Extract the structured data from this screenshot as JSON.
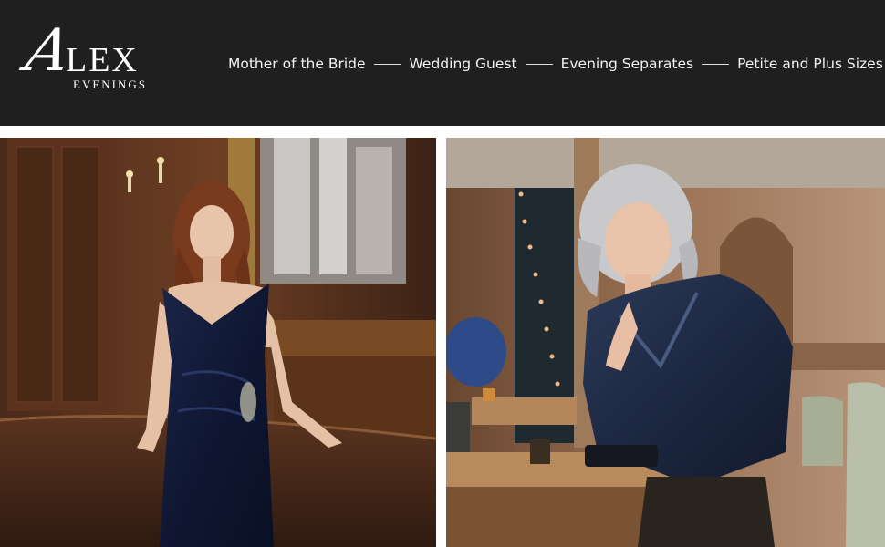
{
  "brand": {
    "logo_initial": "A",
    "logo_word": "LEX",
    "logo_sub": "EVENINGS"
  },
  "nav": {
    "items": [
      {
        "label": "Mother of the Bride"
      },
      {
        "label": "Wedding Guest"
      },
      {
        "label": "Evening Separates"
      },
      {
        "label": "Petite and Plus Sizes"
      }
    ]
  },
  "images": {
    "left_alt": "model-navy-velvet-gown",
    "right_alt": "model-metallic-navy-jacket"
  },
  "colors": {
    "header_bg": "#1f1f1f",
    "nav_text": "#f2f2f2",
    "page_bg": "#ffffff"
  }
}
